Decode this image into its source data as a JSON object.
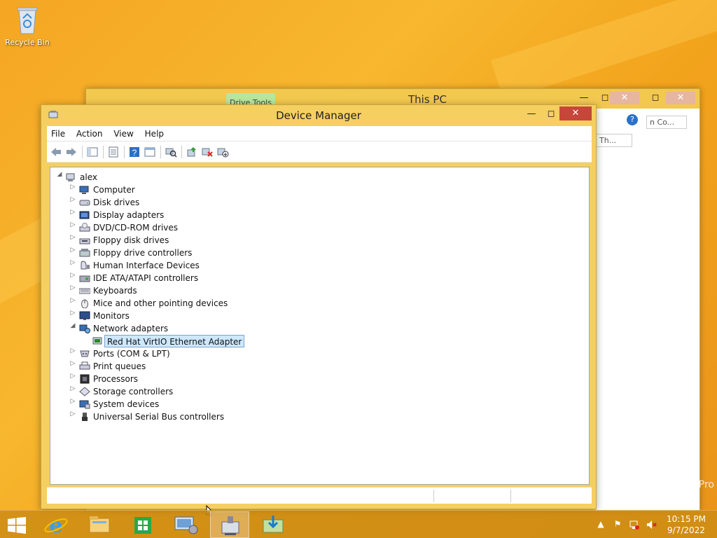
{
  "desktop": {
    "recycle_bin_label": "Recycle Bin",
    "watermark": "Pro"
  },
  "explorer": {
    "title": "This PC",
    "ribbon_tab": "Drive Tools",
    "search1": "Th...",
    "search2": "n Co..."
  },
  "device_manager": {
    "title": "Device Manager",
    "menu": [
      "File",
      "Action",
      "View",
      "Help"
    ],
    "tree": {
      "root": "alex",
      "categories": [
        {
          "label": "Computer",
          "icon": "computer-icon",
          "expanded": false
        },
        {
          "label": "Disk drives",
          "icon": "disk-drive-icon",
          "expanded": false
        },
        {
          "label": "Display adapters",
          "icon": "display-adapter-icon",
          "expanded": false
        },
        {
          "label": "DVD/CD-ROM drives",
          "icon": "dvd-drive-icon",
          "expanded": false
        },
        {
          "label": "Floppy disk drives",
          "icon": "floppy-drive-icon",
          "expanded": false
        },
        {
          "label": "Floppy drive controllers",
          "icon": "floppy-controller-icon",
          "expanded": false
        },
        {
          "label": "Human Interface Devices",
          "icon": "hid-icon",
          "expanded": false
        },
        {
          "label": "IDE ATA/ATAPI controllers",
          "icon": "ide-controller-icon",
          "expanded": false
        },
        {
          "label": "Keyboards",
          "icon": "keyboard-icon",
          "expanded": false
        },
        {
          "label": "Mice and other pointing devices",
          "icon": "mouse-icon",
          "expanded": false
        },
        {
          "label": "Monitors",
          "icon": "monitor-icon",
          "expanded": false
        },
        {
          "label": "Network adapters",
          "icon": "network-adapter-icon",
          "expanded": true,
          "children": [
            {
              "label": "Red Hat VirtIO Ethernet Adapter",
              "icon": "network-card-icon",
              "selected": true
            }
          ]
        },
        {
          "label": "Ports (COM & LPT)",
          "icon": "port-icon",
          "expanded": false
        },
        {
          "label": "Print queues",
          "icon": "printer-icon",
          "expanded": false
        },
        {
          "label": "Processors",
          "icon": "processor-icon",
          "expanded": false
        },
        {
          "label": "Storage controllers",
          "icon": "storage-controller-icon",
          "expanded": false
        },
        {
          "label": "System devices",
          "icon": "system-device-icon",
          "expanded": false
        },
        {
          "label": "Universal Serial Bus controllers",
          "icon": "usb-icon",
          "expanded": false
        }
      ]
    }
  },
  "taskbar": {
    "time": "10:15 PM",
    "date": "9/7/2022"
  },
  "colors": {
    "accent": "#f5cf60",
    "selection": "#cde8ff",
    "close": "#c7463a"
  }
}
